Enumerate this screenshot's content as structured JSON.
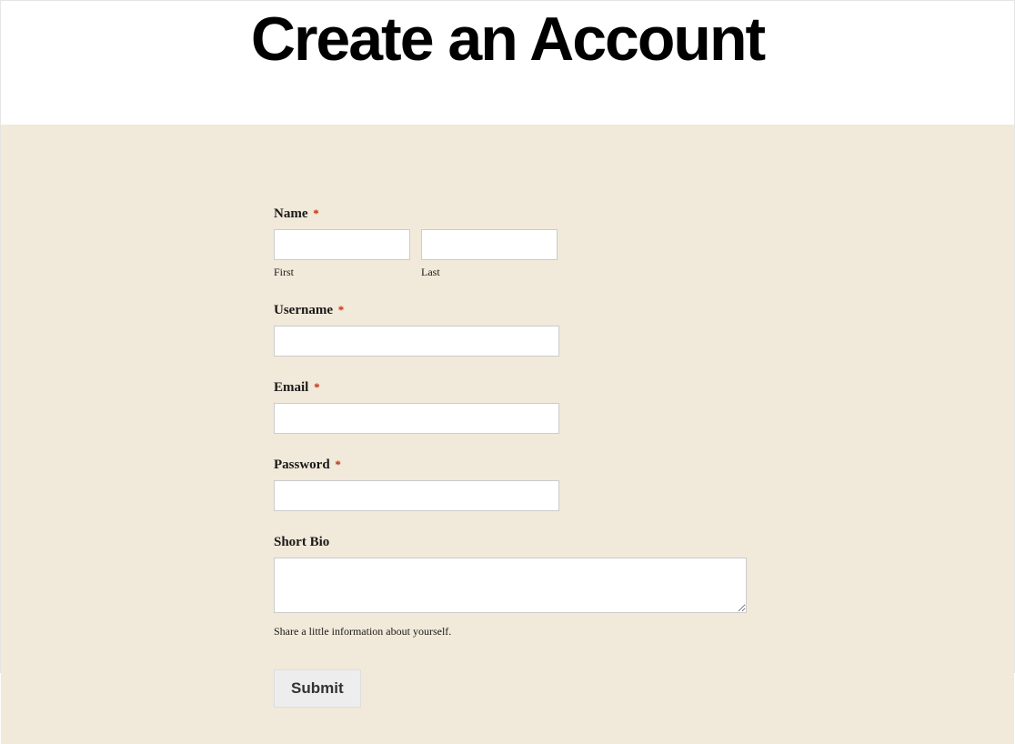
{
  "header": {
    "title": "Create an Account"
  },
  "form": {
    "name": {
      "label": "Name",
      "required": "*",
      "first_sublabel": "First",
      "last_sublabel": "Last",
      "first_value": "",
      "last_value": ""
    },
    "username": {
      "label": "Username",
      "required": "*",
      "value": ""
    },
    "email": {
      "label": "Email",
      "required": "*",
      "value": ""
    },
    "password": {
      "label": "Password",
      "required": "*",
      "value": ""
    },
    "bio": {
      "label": "Short Bio",
      "help": "Share a little information about yourself.",
      "value": ""
    },
    "submit_label": "Submit"
  }
}
